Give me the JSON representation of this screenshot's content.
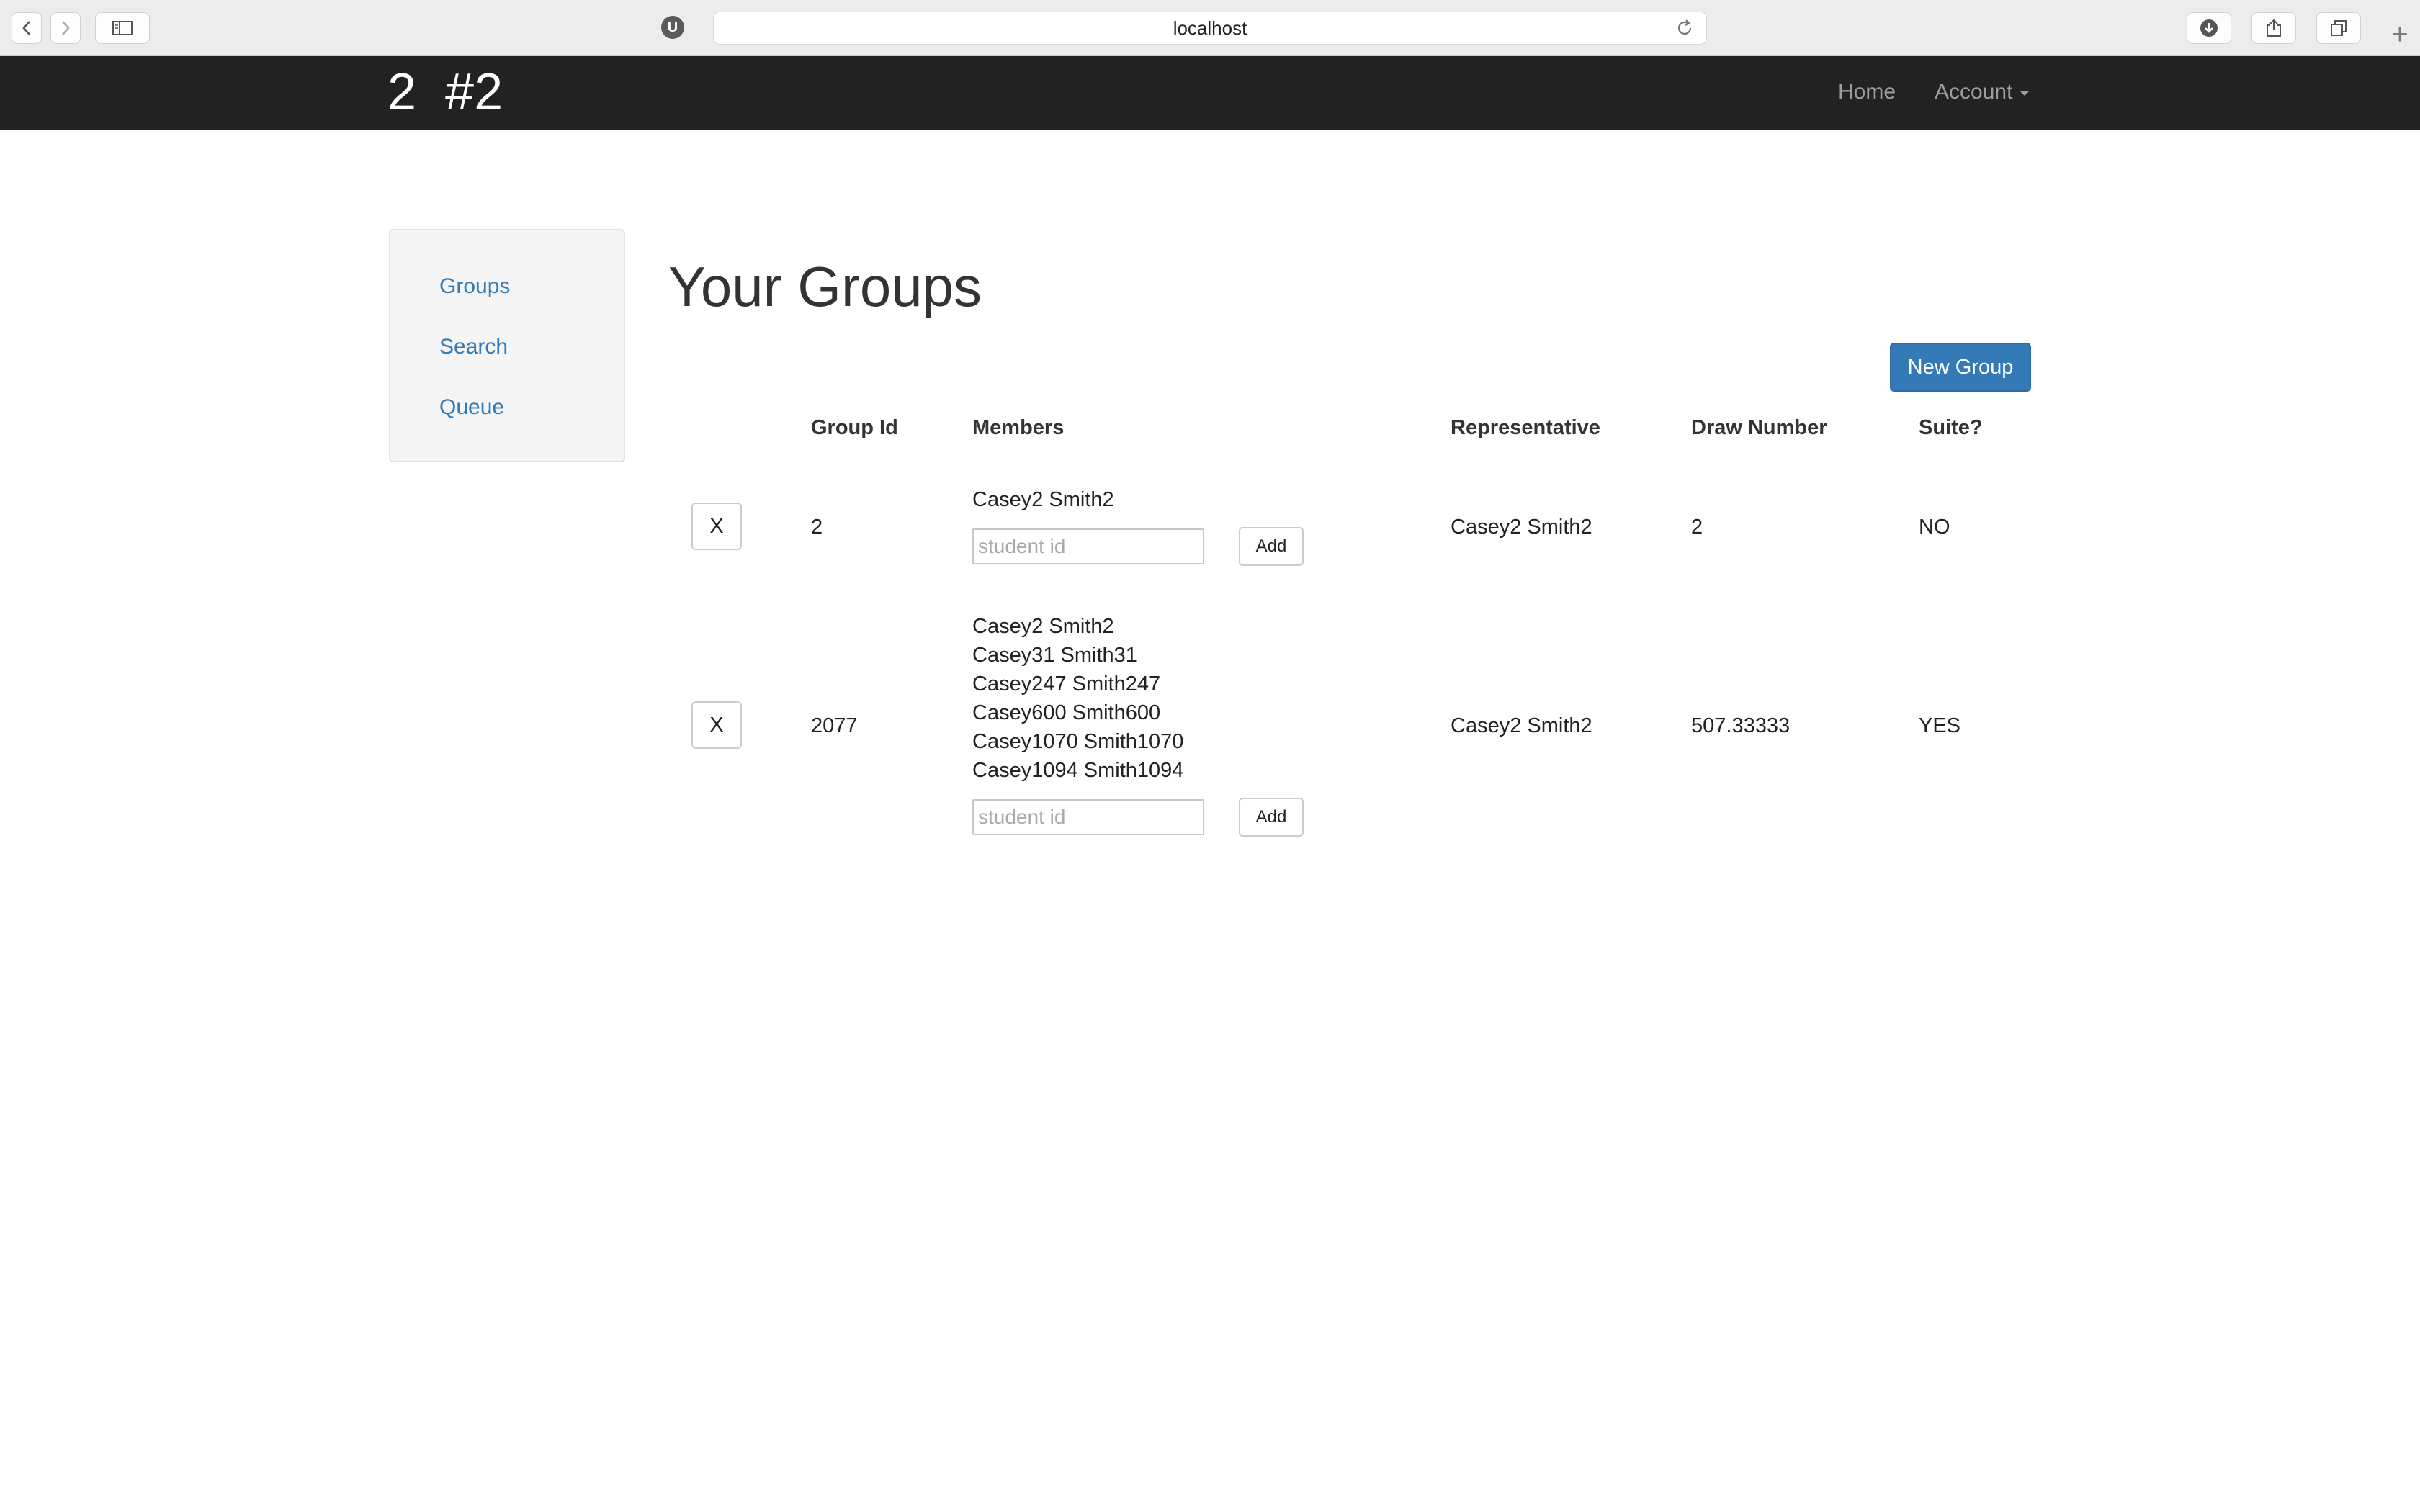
{
  "browser": {
    "url": "localhost",
    "extension_badge": "U",
    "icons": [
      "back-icon",
      "forward-icon",
      "sidebar-icon",
      "reload-icon",
      "download-icon",
      "share-icon",
      "tabs-icon",
      "new-tab-icon"
    ]
  },
  "navbar": {
    "brand": "2  #2",
    "home": "Home",
    "account": "Account"
  },
  "sidebar": {
    "items": [
      {
        "label": "Groups"
      },
      {
        "label": "Search"
      },
      {
        "label": "Queue"
      }
    ]
  },
  "main": {
    "title": "Your Groups",
    "new_group_label": "New Group",
    "columns": [
      "Group Id",
      "Members",
      "Representative",
      "Draw Number",
      "Suite?"
    ],
    "rows": [
      {
        "remove_label": "X",
        "group_id": "2",
        "members": [
          "Casey2 Smith2"
        ],
        "input_placeholder": "student id",
        "add_label": "Add",
        "representative": "Casey2 Smith2",
        "draw_number": "2",
        "suite": "NO"
      },
      {
        "remove_label": "X",
        "group_id": "2077",
        "members": [
          "Casey2 Smith2",
          "Casey31 Smith31",
          "Casey247 Smith247",
          "Casey600 Smith600",
          "Casey1070 Smith1070",
          "Casey1094 Smith1094"
        ],
        "input_placeholder": "student id",
        "add_label": "Add",
        "representative": "Casey2 Smith2",
        "draw_number": "507.33333",
        "suite": "YES"
      }
    ]
  }
}
